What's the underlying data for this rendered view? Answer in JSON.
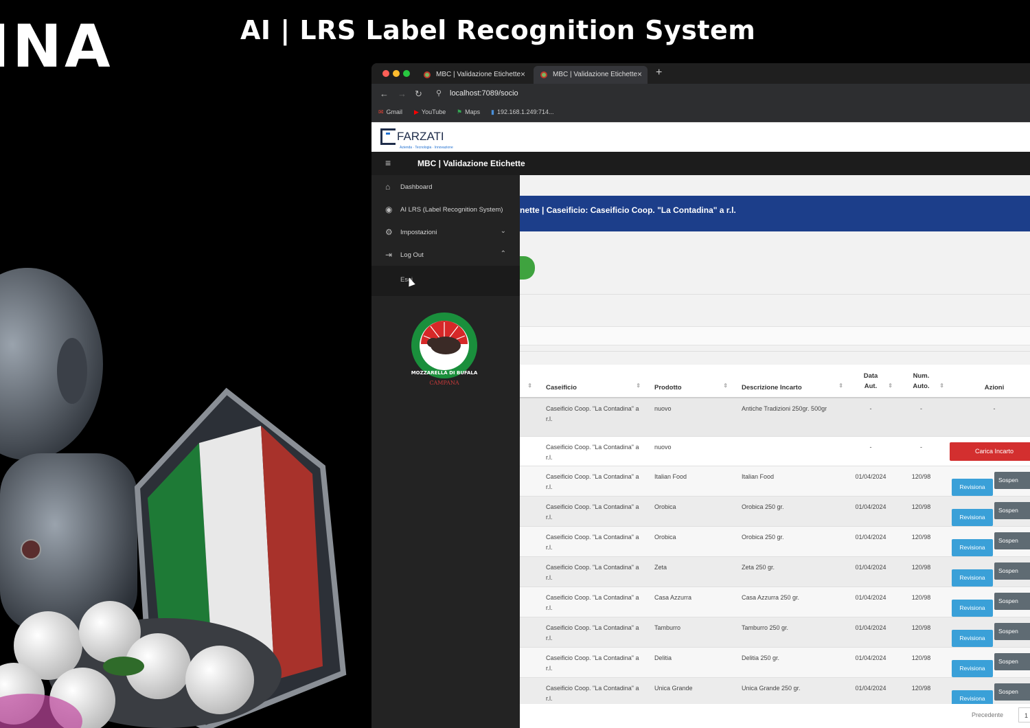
{
  "banner": {
    "brand_partial": "INA",
    "title": "AI | LRS Label Recognition System"
  },
  "browser": {
    "tabs": [
      {
        "label": "MBC | Validazione Etichette"
      },
      {
        "label": "MBC | Validazione Etichette"
      }
    ],
    "new_tab": "+",
    "url": "localhost:7089/socio",
    "bookmarks": [
      "Gmail",
      "YouTube",
      "Maps",
      "192.168.1.249:714..."
    ]
  },
  "app": {
    "logo_text": "FARZATI",
    "logo_sub": "Azienda · Tecnologia · Innovazione",
    "title": "MBC | Validazione Etichette",
    "sidebar": {
      "items": [
        {
          "icon": "home-icon",
          "glyph": "⌂",
          "label": "Dashboard"
        },
        {
          "icon": "eye-icon",
          "glyph": "◉",
          "label": "AI LRS (Label Recognition System)"
        },
        {
          "icon": "gears-icon",
          "glyph": "⚙",
          "label": "Impostazioni",
          "chevron": "⌄"
        },
        {
          "icon": "logout-icon",
          "glyph": "⇥",
          "label": "Log Out",
          "chevron": "⌃"
        }
      ],
      "submenu_item": "Esci",
      "seal_text": [
        "MOZZARELLA DI BUFALA",
        "CAMPANA"
      ]
    },
    "banner": "nette | Caseificio: Caseificio Coop. \"La Contadina\" a r.l.",
    "table": {
      "headers": [
        "",
        "Caseificio",
        "Prodotto",
        "Descrizione Incarto",
        "Data Aut.",
        "Num. Auto.",
        "Azioni"
      ],
      "rows": [
        {
          "caseificio": "Caseificio Coop. \"La Contadina\" a r.l.",
          "prodotto": "nuovo",
          "descrizione": "Antiche Tradizioni 250gr. 500gr",
          "data": "-",
          "num": "-",
          "azioni": "-"
        },
        {
          "caseificio": "Caseificio Coop. \"La Contadina\" a r.l.",
          "prodotto": "nuovo",
          "descrizione": "",
          "data": "-",
          "num": "-",
          "action": "Carica Incarto"
        },
        {
          "caseificio": "Caseificio Coop. \"La Contadina\" a r.l.",
          "prodotto": "Italian Food",
          "descrizione": "Italian Food",
          "data": "01/04/2024",
          "num": "120/98",
          "btn1": "Revisiona",
          "btn2": "Sospen"
        },
        {
          "caseificio": "Caseificio Coop. \"La Contadina\" a r.l.",
          "prodotto": "Orobica",
          "descrizione": "Orobica 250 gr.",
          "data": "01/04/2024",
          "num": "120/98",
          "btn1": "Revisiona",
          "btn2": "Sospen"
        },
        {
          "caseificio": "Caseificio Coop. \"La Contadina\" a r.l.",
          "prodotto": "Orobica",
          "descrizione": "Orobica 250 gr.",
          "data": "01/04/2024",
          "num": "120/98",
          "btn1": "Revisiona",
          "btn2": "Sospen"
        },
        {
          "caseificio": "Caseificio Coop. \"La Contadina\" a r.l.",
          "prodotto": "Zeta",
          "descrizione": "Zeta 250 gr.",
          "data": "01/04/2024",
          "num": "120/98",
          "btn1": "Revisiona",
          "btn2": "Sospen"
        },
        {
          "caseificio": "Caseificio Coop. \"La Contadina\" a r.l.",
          "prodotto": "Casa Azzurra",
          "descrizione": "Casa Azzurra 250 gr.",
          "data": "01/04/2024",
          "num": "120/98",
          "btn1": "Revisiona",
          "btn2": "Sospen"
        },
        {
          "caseificio": "Caseificio Coop. \"La Contadina\" a r.l.",
          "prodotto": "Tamburro",
          "descrizione": "Tamburro 250 gr.",
          "data": "01/04/2024",
          "num": "120/98",
          "btn1": "Revisiona",
          "btn2": "Sospen"
        },
        {
          "caseificio": "Caseificio Coop. \"La Contadina\" a r.l.",
          "prodotto": "Delitia",
          "descrizione": "Delitia 250 gr.",
          "data": "01/04/2024",
          "num": "120/98",
          "btn1": "Revisiona",
          "btn2": "Sospen"
        },
        {
          "caseificio": "Caseificio Coop. \"La Contadina\" a r.l.",
          "prodotto": "Unica Grande",
          "descrizione": "Unica Grande 250 gr.",
          "data": "01/04/2024",
          "num": "120/98",
          "btn1": "Revisiona",
          "btn2": "Sospen"
        }
      ]
    },
    "pager": {
      "prev": "Precedente",
      "page": "1"
    }
  },
  "colors": {
    "banner_blue": "#1c3e8a",
    "action_red": "#d32f2f",
    "revisiona_blue": "#3aa0d8",
    "sospendi_gray": "#5f6b73",
    "green": "#3fa33f"
  }
}
